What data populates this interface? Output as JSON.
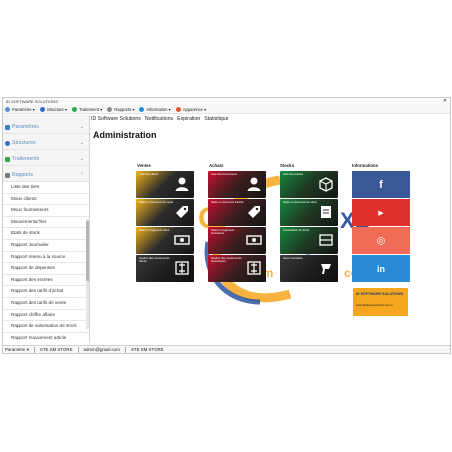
{
  "window": {
    "title": "ID SOFTWARE SOLUTIONS",
    "close": "✕"
  },
  "menubar": [
    {
      "label": "Paramètre ▾",
      "color": "#5b8ed6"
    },
    {
      "label": "Structure ▾",
      "color": "#2f6fcf"
    },
    {
      "label": "Traitement ▾",
      "color": "#2fa84f"
    },
    {
      "label": "Rapports ▾",
      "color": "#8e8e8e"
    },
    {
      "label": "Information ▾",
      "color": "#2a8fd6"
    },
    {
      "label": "Apparence ▾",
      "color": "#e0572a"
    }
  ],
  "sidebar": {
    "sections": [
      {
        "label": "Paramètres",
        "color": "#3c7fd0"
      },
      {
        "label": "Structures",
        "color": "#2f6fcf"
      },
      {
        "label": "Traitements",
        "color": "#2fa84f"
      },
      {
        "label": "Rapports",
        "color": "#7a7a7a"
      }
    ],
    "items": [
      "Liste des tiers",
      "Mouv clients",
      "Mouv fournisseurs",
      "Mouvements/Tier",
      "Etats de stock",
      "Rapport Journalier",
      "Rapport retenu à la source",
      "Rapport de depenses",
      "Rapport des entrées",
      "Rapport des tarifs d'achat",
      "Rapport des tarifs de vente",
      "Rapport chiffre affaire",
      "Rapport de valorisation de stock",
      "Rapport mouvement article"
    ]
  },
  "topnav": [
    "ID Software Solutions",
    "Notifications",
    "Expiration",
    "Statistique"
  ],
  "page_title": "Administration",
  "background": {
    "word1": "C",
    "word2": "XE",
    "word3": "ém",
    "word4": "co"
  },
  "columns": {
    "ventes": {
      "title": "Ventes",
      "tiles": [
        "Liste des clients",
        "Saisir un document de vente",
        "Saisir un reglement client",
        "Gestion des mouvements clients"
      ]
    },
    "achats": {
      "title": "Achats",
      "tiles": [
        "Liste des fournisseurs",
        "Saisir un document d'achat",
        "Saisir un reglement fournisseur",
        "Gestion des mouvements fournisseurs"
      ]
    },
    "stocks": {
      "title": "Stocks",
      "tiles": [
        "Liste des articles",
        "Saisir un document de stock",
        "Consultation de Stock",
        "Gérer Inventaire"
      ]
    },
    "informations": {
      "title": "Informations",
      "tiles": [
        {
          "icon": "facebook-icon",
          "glyph": "f",
          "color": "#3b5998"
        },
        {
          "icon": "youtube-icon",
          "glyph": "▶",
          "color": "#e0302c"
        },
        {
          "icon": "instagram-icon",
          "glyph": "◎",
          "color": "#ef6b55"
        },
        {
          "icon": "linkedin-icon",
          "glyph": "in",
          "color": "#2b8ad6"
        }
      ],
      "logo": {
        "line1": "ID SOFTWARE SOLUTIONS",
        "line2": "www.idsoftwaresolutions.com.tn"
      }
    }
  },
  "statusbar": {
    "paramsLabel": "Paramètre ▾",
    "store1": "STE SM STORE",
    "email": "admin@gmail.com",
    "store2": "STE SM STORE"
  }
}
